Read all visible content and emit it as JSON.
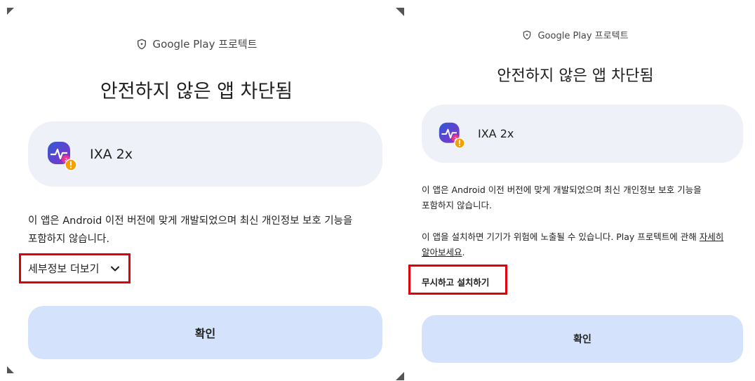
{
  "left": {
    "header": "Google Play 프로텍트",
    "title": "안전하지 않은 앱 차단됨",
    "app_name": "IXA 2x",
    "description_line1": "이 앱은 Android 이전 버전에 맞게 개발되었으며 최신 개인정보 보호 기능을",
    "description_line2": "포함하지 않습니다.",
    "more_details": "세부정보 더보기",
    "confirm": "확인"
  },
  "right": {
    "header": "Google Play 프로텍트",
    "title": "안전하지 않은 앱 차단됨",
    "app_name": "IXA 2x",
    "description_line1": "이 앱은 Android 이전 버전에 맞게 개발되었으며 최신 개인정보 보호 기능을",
    "description_line2": "포함하지 않습니다.",
    "warning_line1": "이 앱을 설치하면 기기가 위험에 노출될 수 있습니다. Play 프로텍트에 관해 ",
    "learn_more_part1": "자세히",
    "learn_more_part2": "알아보세요",
    "warning_end": ".",
    "install_anyway": "무시하고 설치하기",
    "confirm": "확인"
  },
  "colors": {
    "card_bg": "#eef1f7",
    "button_bg": "#d4e3fb",
    "highlight": "#e0000b"
  },
  "icons": [
    "shield-icon",
    "app-icon",
    "warning-badge-icon",
    "chevron-down-icon"
  ]
}
